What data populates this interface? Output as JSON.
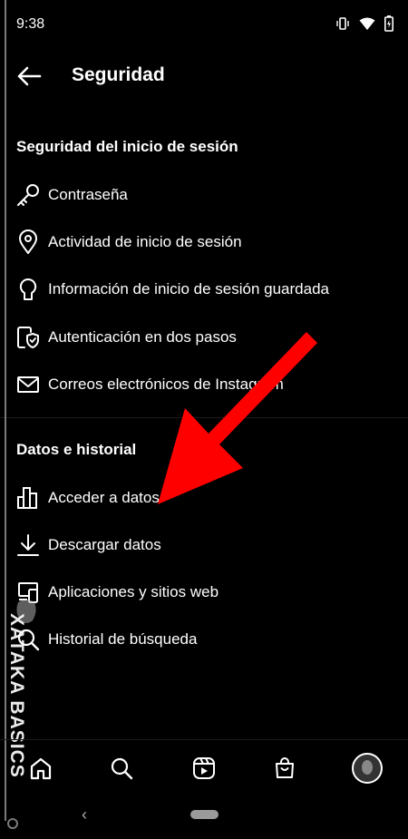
{
  "status_bar": {
    "time": "9:38",
    "icons": [
      "vibrate-icon",
      "wifi-icon",
      "battery-icon"
    ]
  },
  "header": {
    "title": "Seguridad"
  },
  "sections": [
    {
      "title": "Seguridad del inicio de sesión",
      "items": [
        {
          "label": "Contraseña",
          "icon": "key-icon"
        },
        {
          "label": "Actividad de inicio de sesión",
          "icon": "location-pin-icon"
        },
        {
          "label": "Información de inicio de sesión guardada",
          "icon": "keyhole-icon"
        },
        {
          "label": "Autenticación en dos pasos",
          "icon": "shield-phone-icon"
        },
        {
          "label": "Correos electrónicos de Instagram",
          "icon": "mail-icon"
        }
      ]
    },
    {
      "title": "Datos e historial",
      "items": [
        {
          "label": "Acceder a datos",
          "icon": "bar-chart-icon"
        },
        {
          "label": "Descargar datos",
          "icon": "download-icon"
        },
        {
          "label": "Aplicaciones y sitios web",
          "icon": "devices-icon"
        },
        {
          "label": "Historial de búsqueda",
          "icon": "search-icon"
        }
      ]
    }
  ],
  "watermark": {
    "text": "XATAKA BASICS"
  },
  "bottom_nav": {
    "items": [
      "home-icon",
      "search-icon",
      "reels-icon",
      "shop-icon",
      "profile-avatar"
    ]
  },
  "annotation": {
    "color": "#ff0000"
  }
}
